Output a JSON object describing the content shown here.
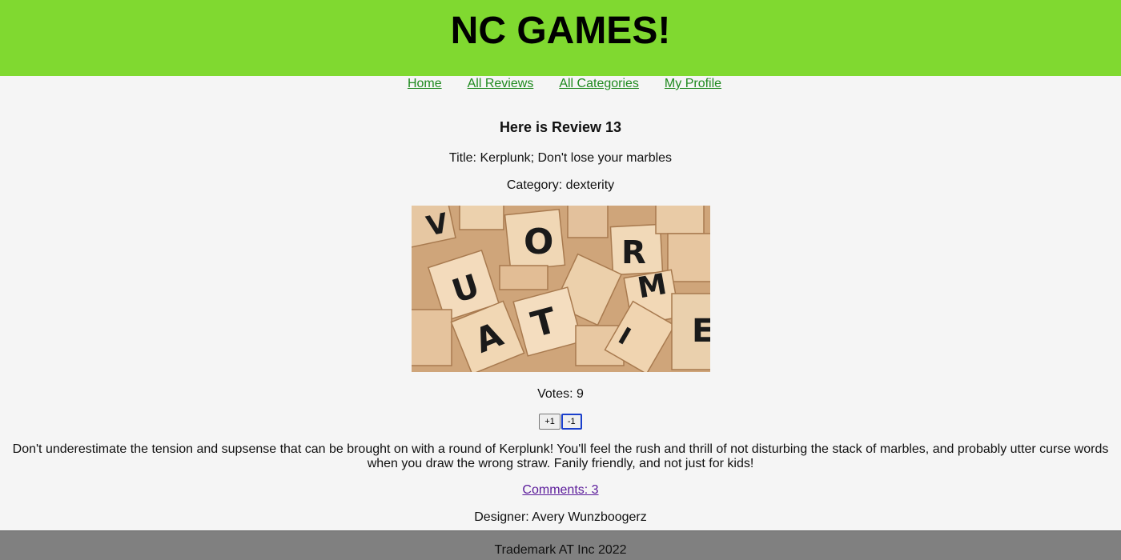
{
  "header": {
    "title": "NC GAMES!"
  },
  "nav": {
    "items": [
      {
        "label": "Home"
      },
      {
        "label": "All Reviews"
      },
      {
        "label": "All Categories"
      },
      {
        "label": "My Profile"
      }
    ]
  },
  "review": {
    "heading": "Here is Review 13",
    "title_line": "Title: Kerplunk; Don't lose your marbles",
    "category_line": "Category: dexterity",
    "image_subject": "scrabble-letter-tiles",
    "votes_line": "Votes: 9",
    "upvote_label": "+1",
    "downvote_label": "-1",
    "body": "Don't underestimate the tension and supsense that can be brought on with a round of Kerplunk! You'll feel the rush and thrill of not disturbing the stack of marbles, and probably utter curse words when you draw the wrong straw. Fanily friendly, and not just for kids!",
    "comments_link": "Comments: 3",
    "designer_line": "Designer: Avery Wunzboogerz"
  },
  "footer": {
    "text": "Trademark AT Inc 2022"
  },
  "colors": {
    "header_bg": "#80d930",
    "nav_link": "#1f8a1f",
    "visited_link": "#5a1a9a",
    "footer_bg": "#808080",
    "page_bg": "#f5f5f5"
  }
}
